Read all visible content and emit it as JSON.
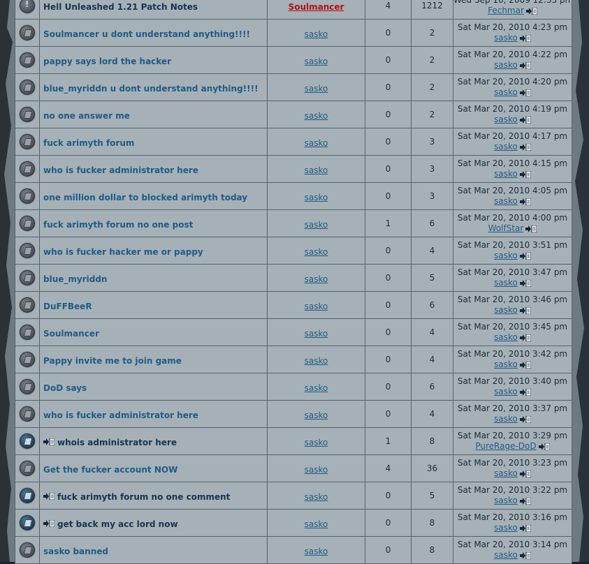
{
  "colors": {
    "link": "#1f5b86",
    "moderator": "#b21010",
    "cell": "#a6b1b7",
    "border": "#56616a"
  },
  "topics": [
    {
      "title": "Hell Unleashed 1.21 Patch Notes",
      "author": "Soulmancer",
      "author_role": "moderator",
      "replies": "4",
      "views": "1212",
      "last_date": "Wed Sep 16, 2009 12:35 pm",
      "last_user": "Fechmar",
      "icon": "announcement-icon",
      "unread": false,
      "new_icon": false
    },
    {
      "title": "Soulmancer u dont understand anything!!!!",
      "author": "sasko",
      "replies": "0",
      "views": "2",
      "last_date": "Sat Mar 20, 2010 4:23 pm",
      "last_user": "sasko",
      "icon": "topic-read-icon",
      "unread": false,
      "new_icon": false
    },
    {
      "title": "pappy says lord the hacker",
      "author": "sasko",
      "replies": "0",
      "views": "2",
      "last_date": "Sat Mar 20, 2010 4:22 pm",
      "last_user": "sasko",
      "icon": "topic-read-icon",
      "unread": false,
      "new_icon": false
    },
    {
      "title": "blue_myriddn u dont understand anything!!!!",
      "author": "sasko",
      "replies": "0",
      "views": "2",
      "last_date": "Sat Mar 20, 2010 4:20 pm",
      "last_user": "sasko",
      "icon": "topic-read-icon",
      "unread": false,
      "new_icon": false
    },
    {
      "title": "no one answer me",
      "author": "sasko",
      "replies": "0",
      "views": "2",
      "last_date": "Sat Mar 20, 2010 4:19 pm",
      "last_user": "sasko",
      "icon": "topic-read-icon",
      "unread": false,
      "new_icon": false
    },
    {
      "title": "fuck arimyth forum",
      "author": "sasko",
      "replies": "0",
      "views": "3",
      "last_date": "Sat Mar 20, 2010 4:17 pm",
      "last_user": "sasko",
      "icon": "topic-read-icon",
      "unread": false,
      "new_icon": false
    },
    {
      "title": "who is fucker administrator here",
      "author": "sasko",
      "replies": "0",
      "views": "3",
      "last_date": "Sat Mar 20, 2010 4:15 pm",
      "last_user": "sasko",
      "icon": "topic-read-icon",
      "unread": false,
      "new_icon": false
    },
    {
      "title": "one million dollar to blocked arimyth today",
      "author": "sasko",
      "replies": "0",
      "views": "3",
      "last_date": "Sat Mar 20, 2010 4:05 pm",
      "last_user": "sasko",
      "icon": "topic-read-icon",
      "unread": false,
      "new_icon": false
    },
    {
      "title": "fuck arimyth forum no one post",
      "author": "sasko",
      "replies": "1",
      "views": "6",
      "last_date": "Sat Mar 20, 2010 4:00 pm",
      "last_user": "WolfStar",
      "icon": "topic-read-icon",
      "unread": false,
      "new_icon": false
    },
    {
      "title": "who is fucker hacker me or pappy",
      "author": "sasko",
      "replies": "0",
      "views": "4",
      "last_date": "Sat Mar 20, 2010 3:51 pm",
      "last_user": "sasko",
      "icon": "topic-read-icon",
      "unread": false,
      "new_icon": false
    },
    {
      "title": "blue_myriddn",
      "author": "sasko",
      "replies": "0",
      "views": "5",
      "last_date": "Sat Mar 20, 2010 3:47 pm",
      "last_user": "sasko",
      "icon": "topic-read-icon",
      "unread": false,
      "new_icon": false
    },
    {
      "title": "DuFFBeeR",
      "author": "sasko",
      "replies": "0",
      "views": "6",
      "last_date": "Sat Mar 20, 2010 3:46 pm",
      "last_user": "sasko",
      "icon": "topic-read-icon",
      "unread": false,
      "new_icon": false
    },
    {
      "title": "Soulmancer",
      "author": "sasko",
      "replies": "0",
      "views": "4",
      "last_date": "Sat Mar 20, 2010 3:45 pm",
      "last_user": "sasko",
      "icon": "topic-read-icon",
      "unread": false,
      "new_icon": false
    },
    {
      "title": "Pappy invite me to join game",
      "author": "sasko",
      "replies": "0",
      "views": "4",
      "last_date": "Sat Mar 20, 2010 3:42 pm",
      "last_user": "sasko",
      "icon": "topic-read-icon",
      "unread": false,
      "new_icon": false
    },
    {
      "title": "DoD says",
      "author": "sasko",
      "replies": "0",
      "views": "6",
      "last_date": "Sat Mar 20, 2010 3:40 pm",
      "last_user": "sasko",
      "icon": "topic-read-icon",
      "unread": false,
      "new_icon": false
    },
    {
      "title": "who is fucker administrator here",
      "author": "sasko",
      "replies": "0",
      "views": "4",
      "last_date": "Sat Mar 20, 2010 3:37 pm",
      "last_user": "sasko",
      "icon": "topic-read-icon",
      "unread": false,
      "new_icon": false
    },
    {
      "title": "whois administrator here",
      "author": "sasko",
      "replies": "1",
      "views": "8",
      "last_date": "Sat Mar 20, 2010 3:29 pm",
      "last_user": "PureRage-DoD",
      "icon": "topic-unread-icon",
      "unread": true,
      "new_icon": true
    },
    {
      "title": "Get the fucker account NOW",
      "author": "sasko",
      "replies": "4",
      "views": "36",
      "last_date": "Sat Mar 20, 2010 3:23 pm",
      "last_user": "sasko",
      "icon": "topic-read-icon",
      "unread": false,
      "new_icon": false
    },
    {
      "title": "fuck arimyth forum no one comment",
      "author": "sasko",
      "replies": "0",
      "views": "5",
      "last_date": "Sat Mar 20, 2010 3:22 pm",
      "last_user": "sasko",
      "icon": "topic-unread-icon",
      "unread": true,
      "new_icon": true
    },
    {
      "title": "get back my acc lord now",
      "author": "sasko",
      "replies": "0",
      "views": "8",
      "last_date": "Sat Mar 20, 2010 3:16 pm",
      "last_user": "sasko",
      "icon": "topic-unread-icon",
      "unread": true,
      "new_icon": true
    },
    {
      "title": "sasko banned",
      "author": "sasko",
      "replies": "0",
      "views": "8",
      "last_date": "Sat Mar 20, 2010 3:14 pm",
      "last_user": "sasko",
      "icon": "topic-read-icon",
      "unread": false,
      "new_icon": false
    }
  ]
}
